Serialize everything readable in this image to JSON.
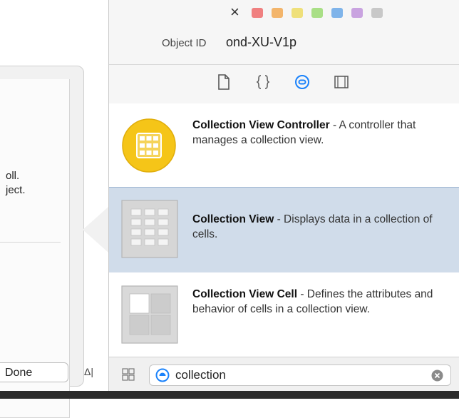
{
  "popover": {
    "text_line1": "oll.",
    "text_line2": "ject.",
    "done_label": "Done",
    "delta_glyph": "Δ"
  },
  "inspector": {
    "close_glyph": "×",
    "label_swatches": [
      "#f08080",
      "#f3b56b",
      "#efe07a",
      "#a9df86",
      "#7fb4ea",
      "#c9a3e0",
      "#c8c8c8"
    ],
    "object_id_label": "Object ID",
    "object_id_value": "ond-XU-V1p",
    "tabs": [
      {
        "icon": "file-template-icon"
      },
      {
        "icon": "code-snippet-icon"
      },
      {
        "icon": "object-library-icon",
        "selected": true
      },
      {
        "icon": "media-library-icon"
      }
    ],
    "accent_color": "#1a82fb"
  },
  "library": {
    "items": [
      {
        "title": "Collection View Controller",
        "desc": " - A controller that manages a collection view.",
        "icon": "collection-view-controller-icon"
      },
      {
        "title": "Collection View",
        "desc": " - Displays data in a collection of cells.",
        "icon": "collection-view-icon",
        "selected": true
      },
      {
        "title": "Collection View Cell",
        "desc": " - Defines the attributes and behavior of cells in a collection view.",
        "icon": "collection-view-cell-icon"
      }
    ]
  },
  "search": {
    "value": "collection"
  }
}
